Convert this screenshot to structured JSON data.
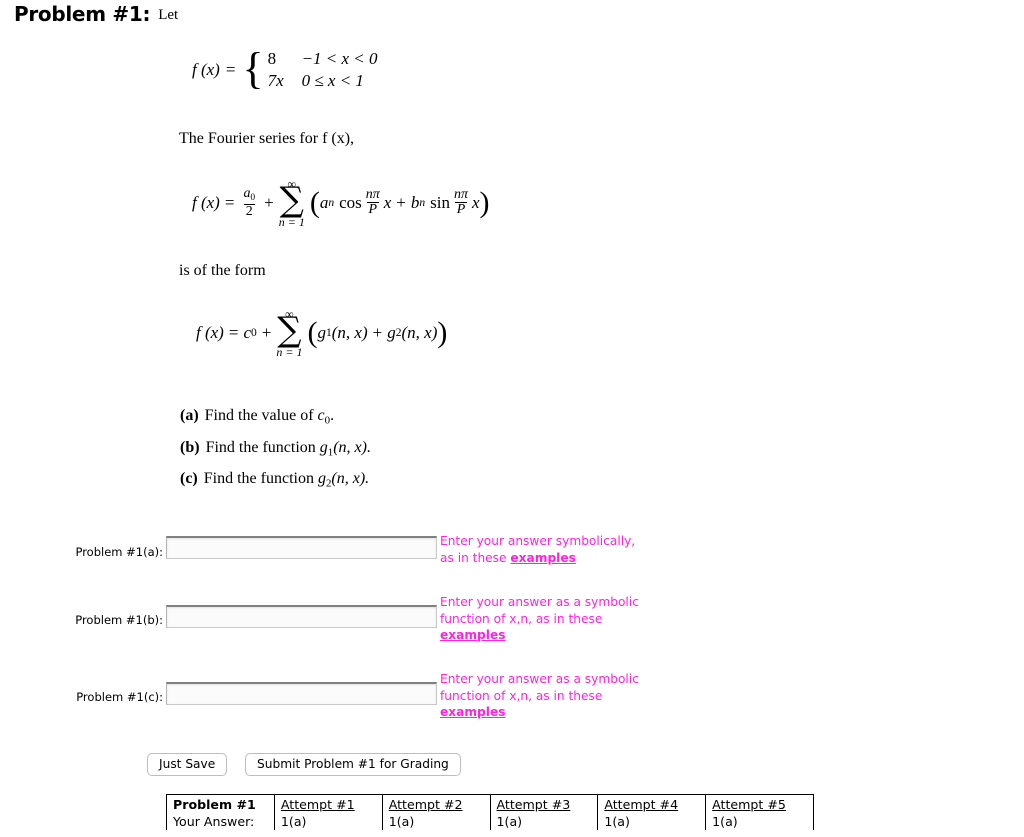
{
  "header": {
    "title": "Problem #1:",
    "lead": "Let"
  },
  "math": {
    "piecewise": {
      "lhs": "f (x)",
      "equals": "=",
      "rows": [
        {
          "value": "8",
          "condition": "−1 < x < 0"
        },
        {
          "value": "7x",
          "condition": "0 ≤ x < 1"
        }
      ]
    },
    "fourier_lead": "The Fourier series for f (x),",
    "fourier_eq": {
      "lhs": "f (x)",
      "equals": "=",
      "a0": "a",
      "a0_sub": "0",
      "denom": "2",
      "plus": "+",
      "sum_top": "∞",
      "sum_bottom": "n = 1",
      "term1_coef": "a",
      "term1_sub": "n",
      "term1_fn": "cos",
      "freq_num": "nπ",
      "freq_den": "P",
      "var": "x",
      "inner_plus": "+",
      "term2_coef": "b",
      "term2_sub": "n",
      "term2_fn": "sin"
    },
    "form_lead": "is of the form",
    "form_eq": {
      "lhs": "f (x)",
      "equals": "=",
      "c0": "c",
      "c0_sub": "0",
      "plus": "+",
      "sum_top": "∞",
      "sum_bottom": "n = 1",
      "g1": "g",
      "g1_sub": "1",
      "g1_args": "(n, x)",
      "inner_plus": "+",
      "g2": "g",
      "g2_sub": "2",
      "g2_args": "(n, x)"
    }
  },
  "parts": [
    {
      "tag": "(a)",
      "text_pre": "Find the value of ",
      "sym": "c",
      "sym_sub": "0",
      "text_post": "."
    },
    {
      "tag": "(b)",
      "text_pre": "Find the function ",
      "sym": "g",
      "sym_sub": "1",
      "text_post": "(n, x)."
    },
    {
      "tag": "(c)",
      "text_pre": "Find the function ",
      "sym": "g",
      "sym_sub": "2",
      "text_post": "(n, x)."
    }
  ],
  "answers": [
    {
      "label": "Problem #1(a):",
      "value": "",
      "placeholder": "",
      "hint_line1": "Enter your answer symbolically,",
      "hint_line2": "as in these ",
      "hint_link": "examples",
      "hint_line3": ""
    },
    {
      "label": "Problem #1(b):",
      "value": "",
      "placeholder": "",
      "hint_line1": "Enter your answer as a symbolic",
      "hint_line2": "function of x,n, as in these",
      "hint_link": "examples",
      "hint_line3": ""
    },
    {
      "label": "Problem #1(c):",
      "value": "",
      "placeholder": "",
      "hint_line1": "Enter your answer as a symbolic",
      "hint_line2": "function of x,n, as in these",
      "hint_link": "examples",
      "hint_line3": ""
    }
  ],
  "buttons": {
    "just_save": "Just Save",
    "submit": "Submit Problem #1 for Grading"
  },
  "attempts_table": {
    "headers": [
      "Problem #1",
      "Attempt #1",
      "Attempt #2",
      "Attempt #3",
      "Attempt #4",
      "Attempt #5"
    ],
    "rows": [
      {
        "label": "Your Answer:",
        "cells": [
          "1(a)",
          "1(a)",
          "1(a)",
          "1(a)",
          "1(a)"
        ]
      }
    ]
  },
  "colors": {
    "hint_magenta": "#ff22e0",
    "text": "#000000",
    "background": "#ffffff",
    "input_border": "#c9c9c9",
    "button_border": "#bdbdbd"
  }
}
